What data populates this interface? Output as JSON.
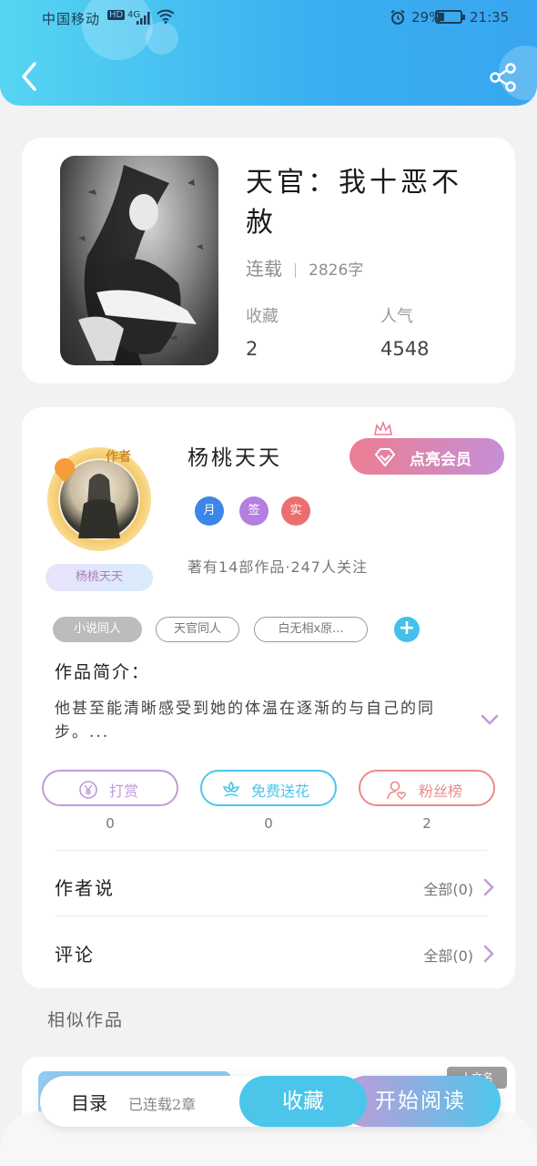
{
  "status_bar": {
    "carrier": "中国移动",
    "hd": "HD",
    "network": "4G",
    "battery_percent": "29%",
    "battery_level": 0.29,
    "time": "21:35"
  },
  "header": {
    "back_icon": "chevron-left-icon",
    "share_icon": "share-icon"
  },
  "book": {
    "title": "天官：我十恶不赦",
    "status": "连载",
    "word_count": "2826字",
    "favorites_label": "收藏",
    "favorites_value": "2",
    "popularity_label": "人气",
    "popularity_value": "4548"
  },
  "author": {
    "frame_tag": "作者",
    "banner_name": "杨桃天天",
    "name": "杨桃天天",
    "vip_button": "点亮会员",
    "badges": [
      {
        "label": "月",
        "color": "#3b86e6"
      },
      {
        "label": "签",
        "color": "#b37fe0"
      },
      {
        "label": "实",
        "color": "#ec6f6f"
      }
    ],
    "stats": "著有14部作品·247人关注"
  },
  "tags": [
    "小说同人",
    "天官同人",
    "白无相x原..."
  ],
  "intro": {
    "heading": "作品简介：",
    "text": "他甚至能清晰感受到她的体温在逐渐的与自己的同步。..."
  },
  "actions": [
    {
      "label": "打赏",
      "count": "0",
      "color": "#c19ad8",
      "icon": "yen-icon"
    },
    {
      "label": "免费送花",
      "count": "0",
      "color": "#4bc6ea",
      "icon": "flower-icon"
    },
    {
      "label": "粉丝榜",
      "count": "2",
      "color": "#ec8a8a",
      "icon": "fan-icon"
    }
  ],
  "rows": {
    "author_says": {
      "label": "作者说",
      "right": "全部(0)"
    },
    "comments": {
      "label": "评论",
      "right": "全部(0)"
    }
  },
  "similar": {
    "heading": "相似作品",
    "badge": "人文名"
  },
  "bottom_bar": {
    "toc": "目录",
    "chapters": "已连载2章",
    "favorite_button": "收藏",
    "read_button": "开始阅读"
  }
}
